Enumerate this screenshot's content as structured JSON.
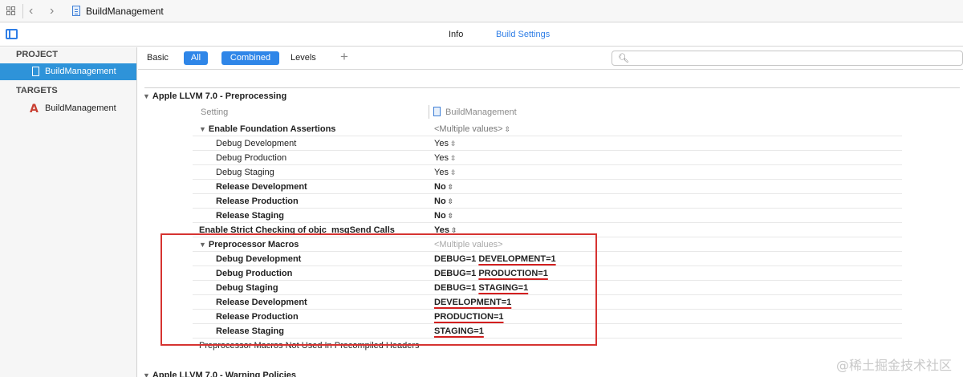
{
  "window": {
    "title": "BuildManagement"
  },
  "tabs": {
    "info": "Info",
    "build_settings": "Build Settings"
  },
  "navigator": {
    "project_header": "PROJECT",
    "project_item": "BuildManagement",
    "targets_header": "TARGETS",
    "target_item": "BuildManagement"
  },
  "filter": {
    "basic": "Basic",
    "all": "All",
    "combined": "Combined",
    "levels": "Levels",
    "add": "+",
    "search_value": ""
  },
  "section": {
    "title": "Apple LLVM 7.0 - Preprocessing",
    "col_setting": "Setting",
    "col_target": "BuildManagement"
  },
  "rows": [
    {
      "name": "Enable Foundation Assertions",
      "value": "<Multiple values>"
    },
    {
      "name": "Debug Development",
      "value": "Yes"
    },
    {
      "name": "Debug Production",
      "value": "Yes"
    },
    {
      "name": "Debug Staging",
      "value": "Yes"
    },
    {
      "name": "Release Development",
      "value": "No"
    },
    {
      "name": "Release Production",
      "value": "No"
    },
    {
      "name": "Release Staging",
      "value": "No"
    },
    {
      "name": "Enable Strict Checking of objc_msgSend Calls",
      "value": "Yes"
    },
    {
      "name": "Preprocessor Macros",
      "value": "<Multiple values>"
    },
    {
      "name": "Debug Development",
      "value_prefix": "DEBUG=1",
      "value_mark": "DEVELOPMENT=1"
    },
    {
      "name": "Debug Production",
      "value_prefix": "DEBUG=1",
      "value_mark": "PRODUCTION=1"
    },
    {
      "name": "Debug Staging",
      "value_prefix": "DEBUG=1",
      "value_mark": "STAGING=1"
    },
    {
      "name": "Release Development",
      "value_mark": "DEVELOPMENT=1"
    },
    {
      "name": "Release Production",
      "value_mark": "PRODUCTION=1"
    },
    {
      "name": "Release Staging",
      "value_mark": "STAGING=1"
    },
    {
      "name": "Preprocessor Macros Not Used In Precompiled Headers",
      "value": ""
    }
  ],
  "next_section": "Apple LLVM 7.0 - Warning Policies",
  "watermark": "@稀土掘金技术社区",
  "colors": {
    "accent": "#2f86e8",
    "selection": "#2e93d9",
    "annotation_red": "#d63331"
  }
}
